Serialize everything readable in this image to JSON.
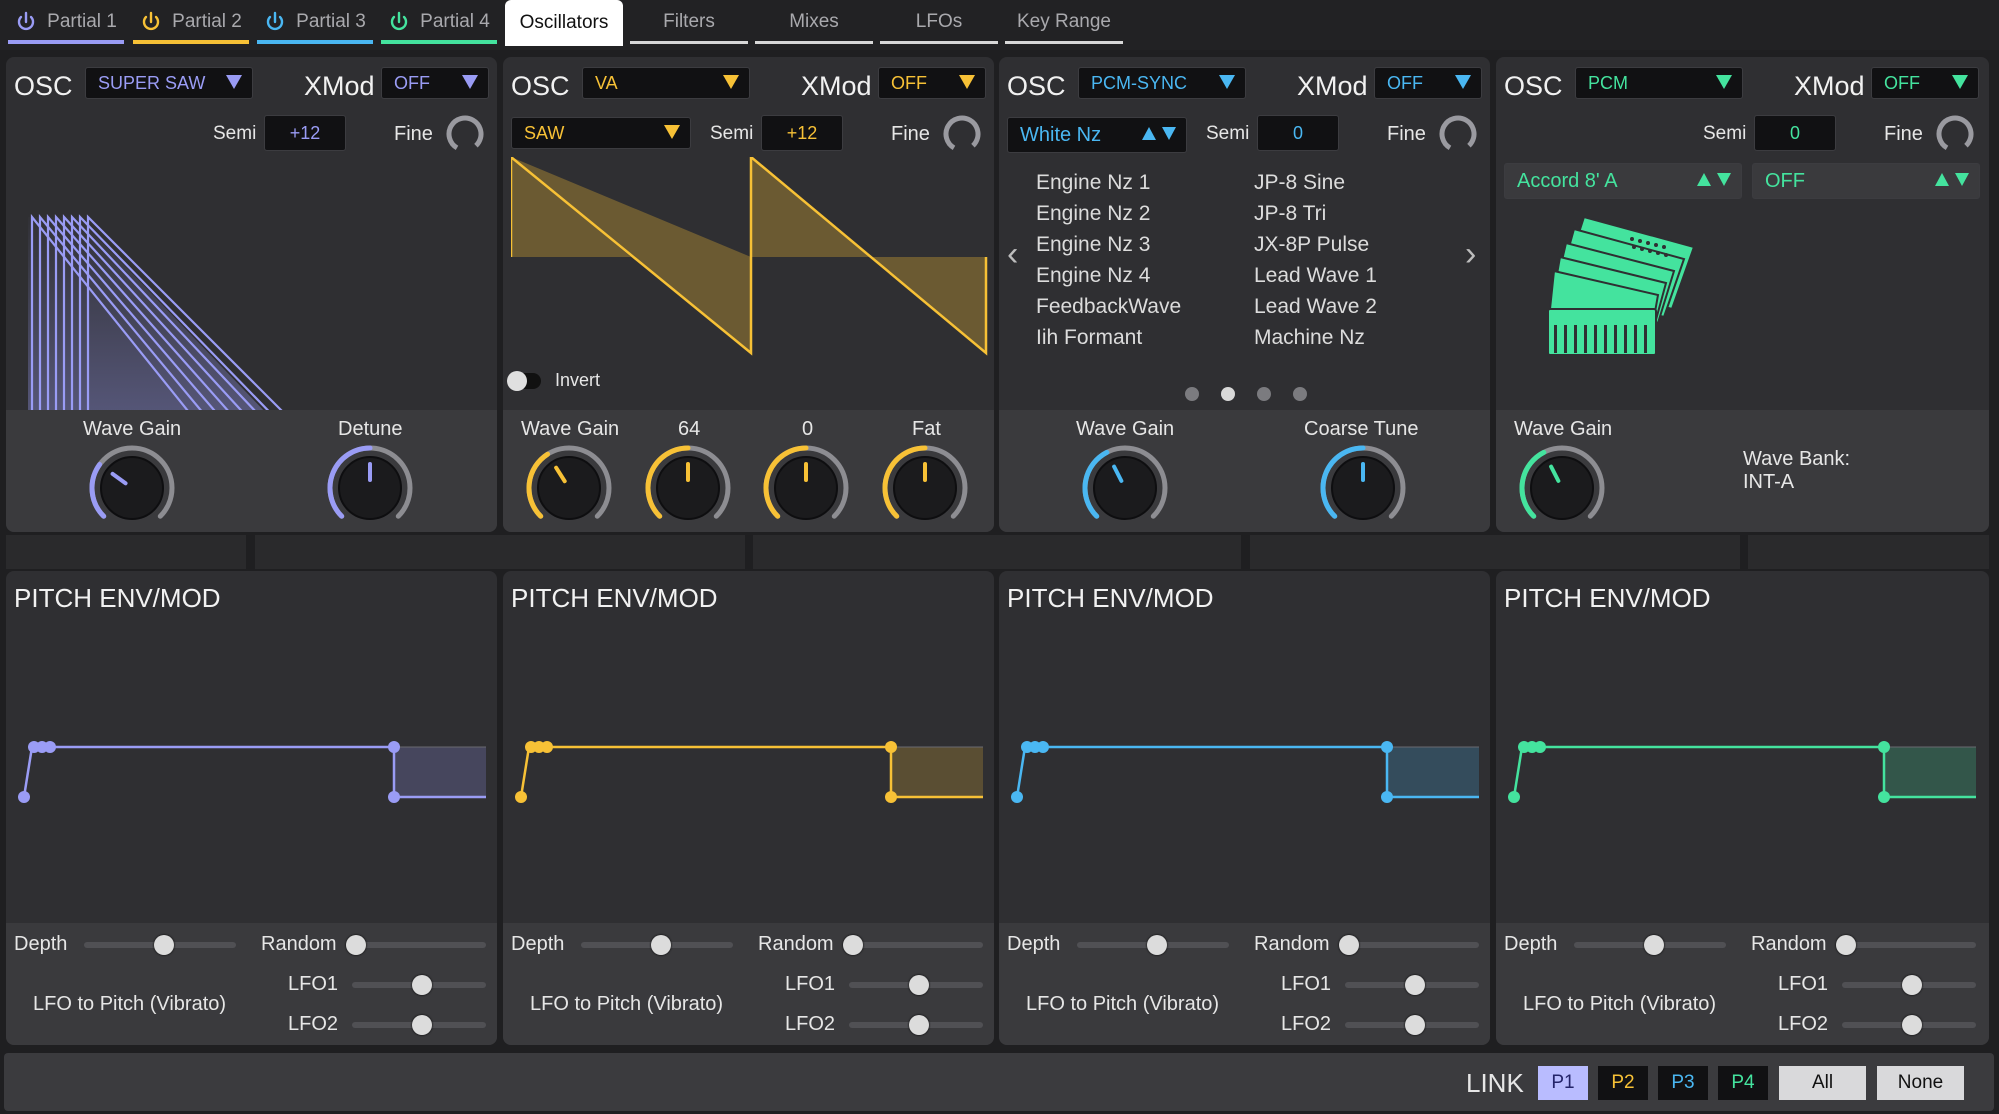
{
  "colors": {
    "p1": "#9a9cf5",
    "p2": "#f7c136",
    "p3": "#4ab7f2",
    "p4": "#44e39e"
  },
  "partial_tabs": [
    {
      "label": "Partial 1",
      "color": "#9a9cf5"
    },
    {
      "label": "Partial 2",
      "color": "#f7c136"
    },
    {
      "label": "Partial 3",
      "color": "#4ab7f2"
    },
    {
      "label": "Partial 4",
      "color": "#44e39e"
    }
  ],
  "nav_tabs": [
    "Oscillators",
    "Filters",
    "Mixes",
    "LFOs",
    "Key Range"
  ],
  "active_tab": "Oscillators",
  "osc": [
    {
      "osc_label": "OSC",
      "type": "SUPER SAW",
      "xmod_label": "XMod",
      "xmod": "OFF",
      "semi_label": "Semi",
      "semi": "+12",
      "fine_label": "Fine",
      "knobs": [
        {
          "label": "Wave Gain",
          "value": 0.3
        },
        {
          "label": "Detune",
          "value": 0.5
        }
      ]
    },
    {
      "osc_label": "OSC",
      "type": "VA",
      "xmod_label": "XMod",
      "xmod": "OFF",
      "wave": "SAW",
      "semi_label": "Semi",
      "semi": "+12",
      "fine_label": "Fine",
      "invert_label": "Invert",
      "knobs": [
        {
          "label": "Wave Gain",
          "value": 0.38
        },
        {
          "label": "64",
          "value": 0.5
        },
        {
          "label": "0",
          "value": 0.5
        },
        {
          "label": "Fat",
          "value": 0.5
        }
      ]
    },
    {
      "osc_label": "OSC",
      "type": "PCM-SYNC",
      "xmod_label": "XMod",
      "xmod": "OFF",
      "wave": "White Nz",
      "semi_label": "Semi",
      "semi": "0",
      "fine_label": "Fine",
      "wave_list_left": [
        "Engine Nz 1",
        "Engine Nz 2",
        "Engine Nz 3",
        "Engine Nz 4",
        "FeedbackWave",
        "Iih Formant"
      ],
      "wave_list_right": [
        "JP-8 Sine",
        "JP-8 Tri",
        "JX-8P Pulse",
        "Lead Wave 1",
        "Lead Wave 2",
        "Machine Nz"
      ],
      "page_dots": 4,
      "active_dot": 2,
      "knobs": [
        {
          "label": "Wave Gain",
          "value": 0.4
        },
        {
          "label": "Coarse Tune",
          "value": 0.5
        }
      ]
    },
    {
      "osc_label": "OSC",
      "type": "PCM",
      "xmod_label": "XMod",
      "xmod": "OFF",
      "semi_label": "Semi",
      "semi": "0",
      "fine_label": "Fine",
      "wave_a": "Accord 8' A",
      "wave_b": "OFF",
      "bank_label": "Wave Bank:",
      "bank": "INT-A",
      "knobs": [
        {
          "label": "Wave Gain",
          "value": 0.4
        }
      ]
    }
  ],
  "pitch": [
    {
      "title": "PITCH ENV/MOD",
      "depth_label": "Depth",
      "random_label": "Random",
      "lfo_label": "LFO to Pitch (Vibrato)",
      "lfo1_label": "LFO1",
      "lfo2_label": "LFO2",
      "depth": 0.53,
      "random": 0.0,
      "lfo1": 0.53,
      "lfo2": 0.53
    },
    {
      "title": "PITCH ENV/MOD",
      "depth_label": "Depth",
      "random_label": "Random",
      "lfo_label": "LFO to Pitch (Vibrato)",
      "lfo1_label": "LFO1",
      "lfo2_label": "LFO2",
      "depth": 0.53,
      "random": 0.0,
      "lfo1": 0.53,
      "lfo2": 0.53
    },
    {
      "title": "PITCH ENV/MOD",
      "depth_label": "Depth",
      "random_label": "Random",
      "lfo_label": "LFO to Pitch (Vibrato)",
      "lfo1_label": "LFO1",
      "lfo2_label": "LFO2",
      "depth": 0.53,
      "random": 0.0,
      "lfo1": 0.53,
      "lfo2": 0.53
    },
    {
      "title": "PITCH ENV/MOD",
      "depth_label": "Depth",
      "random_label": "Random",
      "lfo_label": "LFO to Pitch (Vibrato)",
      "lfo1_label": "LFO1",
      "lfo2_label": "LFO2",
      "depth": 0.53,
      "random": 0.0,
      "lfo1": 0.53,
      "lfo2": 0.53
    }
  ],
  "link": {
    "label": "LINK",
    "buttons": [
      "P1",
      "P2",
      "P3",
      "P4"
    ],
    "active": "P1",
    "all": "All",
    "none": "None"
  }
}
